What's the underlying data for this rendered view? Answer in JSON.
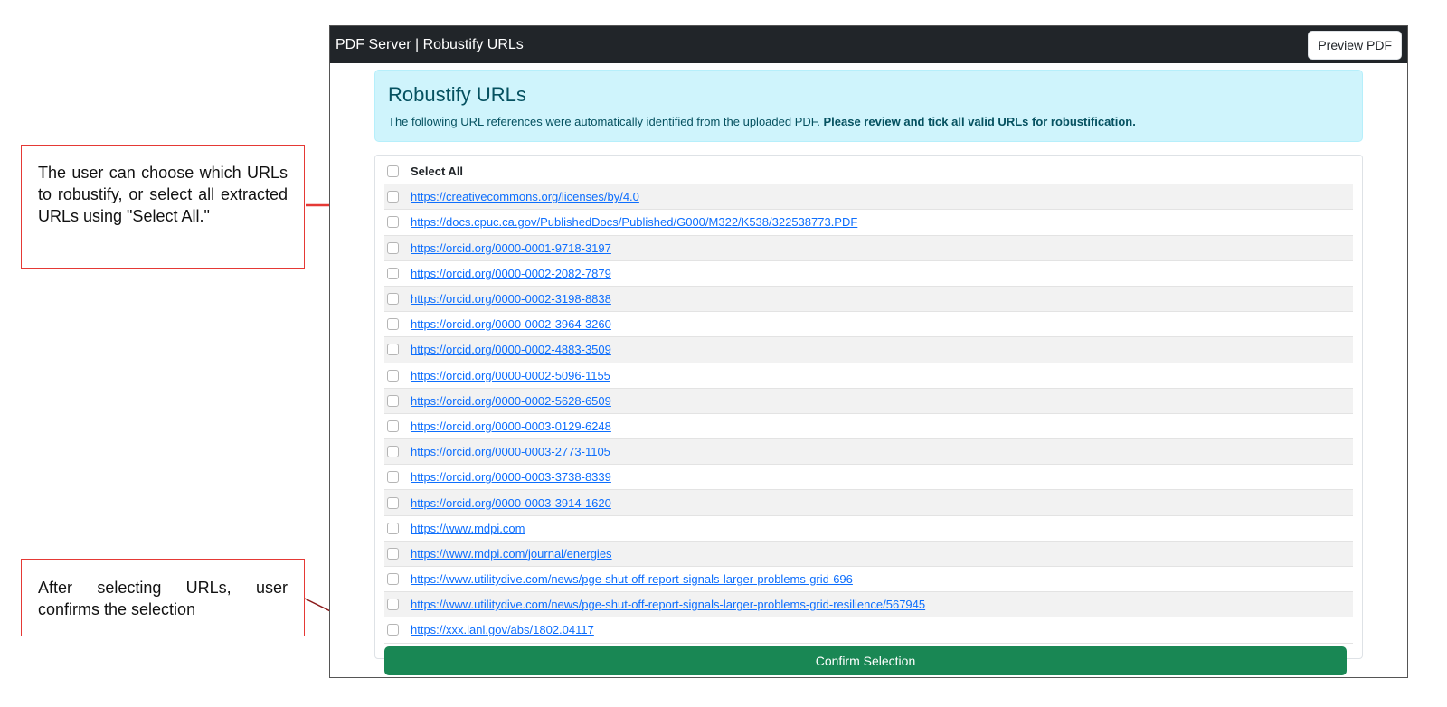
{
  "annotations": {
    "choose_urls": "The user can choose which URLs to robustify, or select all extracted URLs using \"Select All.\"",
    "confirm": "After selecting URLs, user confirms the selection"
  },
  "navbar": {
    "brand": "PDF Server | Robustify URLs",
    "preview_button": "Preview PDF",
    "bg_color": "#212529"
  },
  "alert": {
    "title": "Robustify URLs",
    "text_plain": "The following URL references were automatically identified from the uploaded PDF. ",
    "text_bold_1": "Please review and ",
    "text_bold_link": "tick",
    "text_bold_2": " all valid URLs for robustification.",
    "bg_color": "#cff4fc"
  },
  "url_list": {
    "select_all_label": "Select All",
    "urls": [
      "https://creativecommons.org/licenses/by/4.0",
      "https://docs.cpuc.ca.gov/PublishedDocs/Published/G000/M322/K538/322538773.PDF",
      "https://orcid.org/0000-0001-9718-3197",
      "https://orcid.org/0000-0002-2082-7879",
      "https://orcid.org/0000-0002-3198-8838",
      "https://orcid.org/0000-0002-3964-3260",
      "https://orcid.org/0000-0002-4883-3509",
      "https://orcid.org/0000-0002-5096-1155",
      "https://orcid.org/0000-0002-5628-6509",
      "https://orcid.org/0000-0003-0129-6248",
      "https://orcid.org/0000-0003-2773-1105",
      "https://orcid.org/0000-0003-3738-8339",
      "https://orcid.org/0000-0003-3914-1620",
      "https://www.mdpi.com",
      "https://www.mdpi.com/journal/energies",
      "https://www.utilitydive.com/news/pge-shut-off-report-signals-larger-problems-grid-696",
      "https://www.utilitydive.com/news/pge-shut-off-report-signals-larger-problems-grid-resilience/567945",
      "https://xxx.lanl.gov/abs/1802.04117"
    ]
  },
  "confirm_button": {
    "label": "Confirm Selection",
    "color": "#198754"
  },
  "colors": {
    "callout_border": "#e53935",
    "arrow_red": "#e53935",
    "arrow_dark": "#8b1a1a",
    "link": "#0d6efd"
  }
}
